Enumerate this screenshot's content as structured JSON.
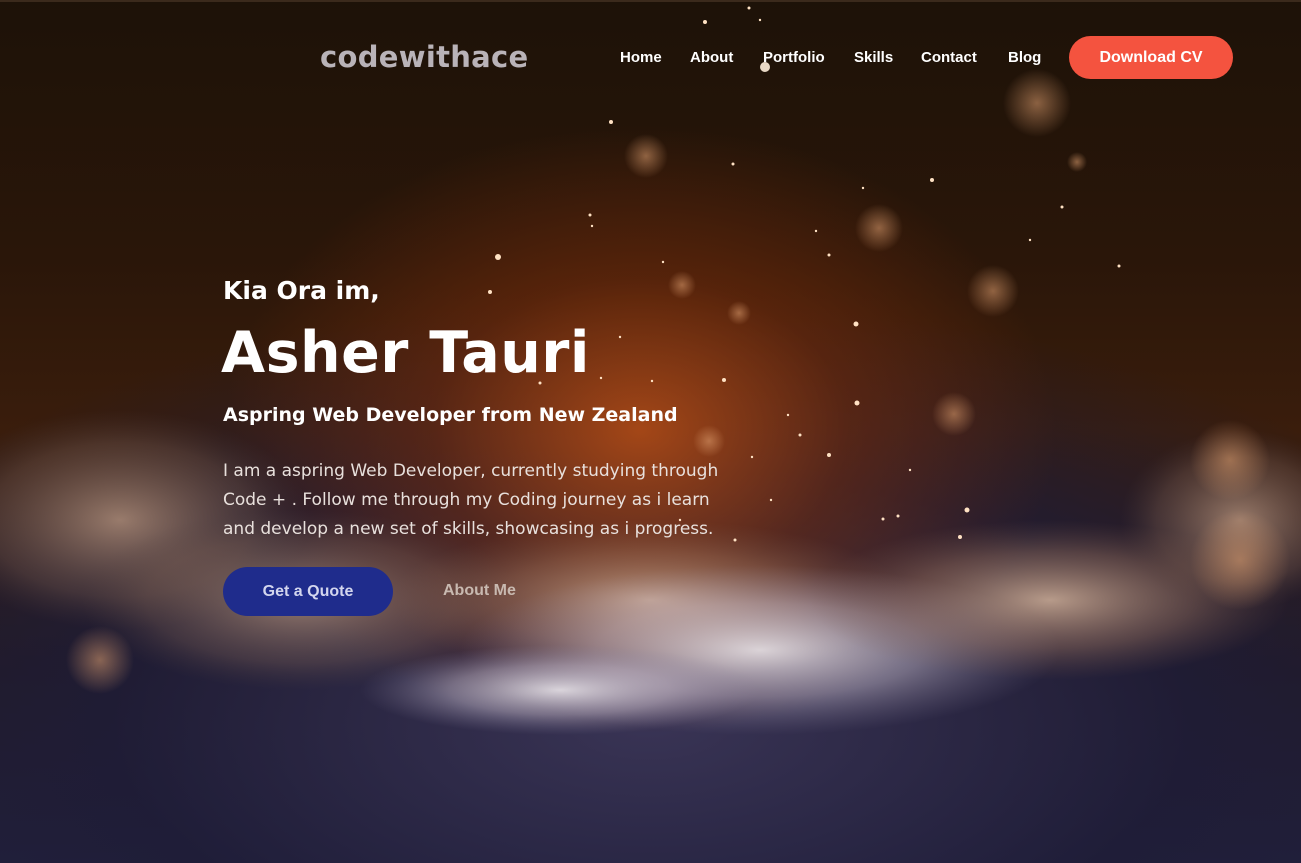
{
  "brand": {
    "logo_text": "codewithace"
  },
  "nav": {
    "items": [
      {
        "label": "Home"
      },
      {
        "label": "About"
      },
      {
        "label": "Portfolio"
      },
      {
        "label": "Skills"
      },
      {
        "label": "Contact"
      },
      {
        "label": "Blog"
      }
    ],
    "download_label": "Download CV"
  },
  "hero": {
    "greeting": "Kia Ora im,",
    "name": "Asher Tauri",
    "subtitle": "Aspring Web Developer from New Zealand",
    "description": "I am a aspring Web Developer, currently studying through Code + . Follow me through my Coding journey as i learn and develop a new set of skills, showcasing as i progress.",
    "primary_button": "Get a Quote",
    "secondary_button": "About Me"
  },
  "colors": {
    "accent": "#f4533f",
    "primary_button": "#1f2c8c",
    "background_dark": "#1d1208",
    "background_glow": "#b94e14"
  }
}
